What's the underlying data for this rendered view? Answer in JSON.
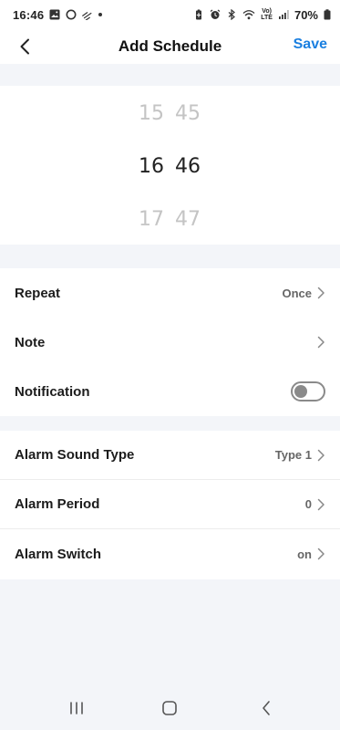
{
  "status_bar": {
    "time": "16:46",
    "volte_top": "Vo)",
    "volte_bottom": "LTE",
    "battery": "70%"
  },
  "header": {
    "title": "Add Schedule",
    "save_label": "Save"
  },
  "time_picker": {
    "hours": {
      "prev": "15",
      "selected": "16",
      "next": "17"
    },
    "minutes": {
      "prev": "45",
      "selected": "46",
      "next": "47"
    }
  },
  "settings": {
    "repeat": {
      "label": "Repeat",
      "value": "Once"
    },
    "note": {
      "label": "Note"
    },
    "notification": {
      "label": "Notification",
      "enabled": false
    }
  },
  "alarm": {
    "sound_type": {
      "label": "Alarm Sound Type",
      "value": "Type 1"
    },
    "period": {
      "label": "Alarm Period",
      "value": "0"
    },
    "switch": {
      "label": "Alarm Switch",
      "value": "on"
    }
  },
  "colors": {
    "accent": "#1a7fe0",
    "background": "#f3f5f9",
    "surface": "#ffffff"
  },
  "icons": {
    "back": "chevron-left-icon",
    "chevron": "chevron-right-icon",
    "nav_recent": "recent-apps-icon",
    "nav_home": "home-icon",
    "nav_back": "back-icon"
  }
}
